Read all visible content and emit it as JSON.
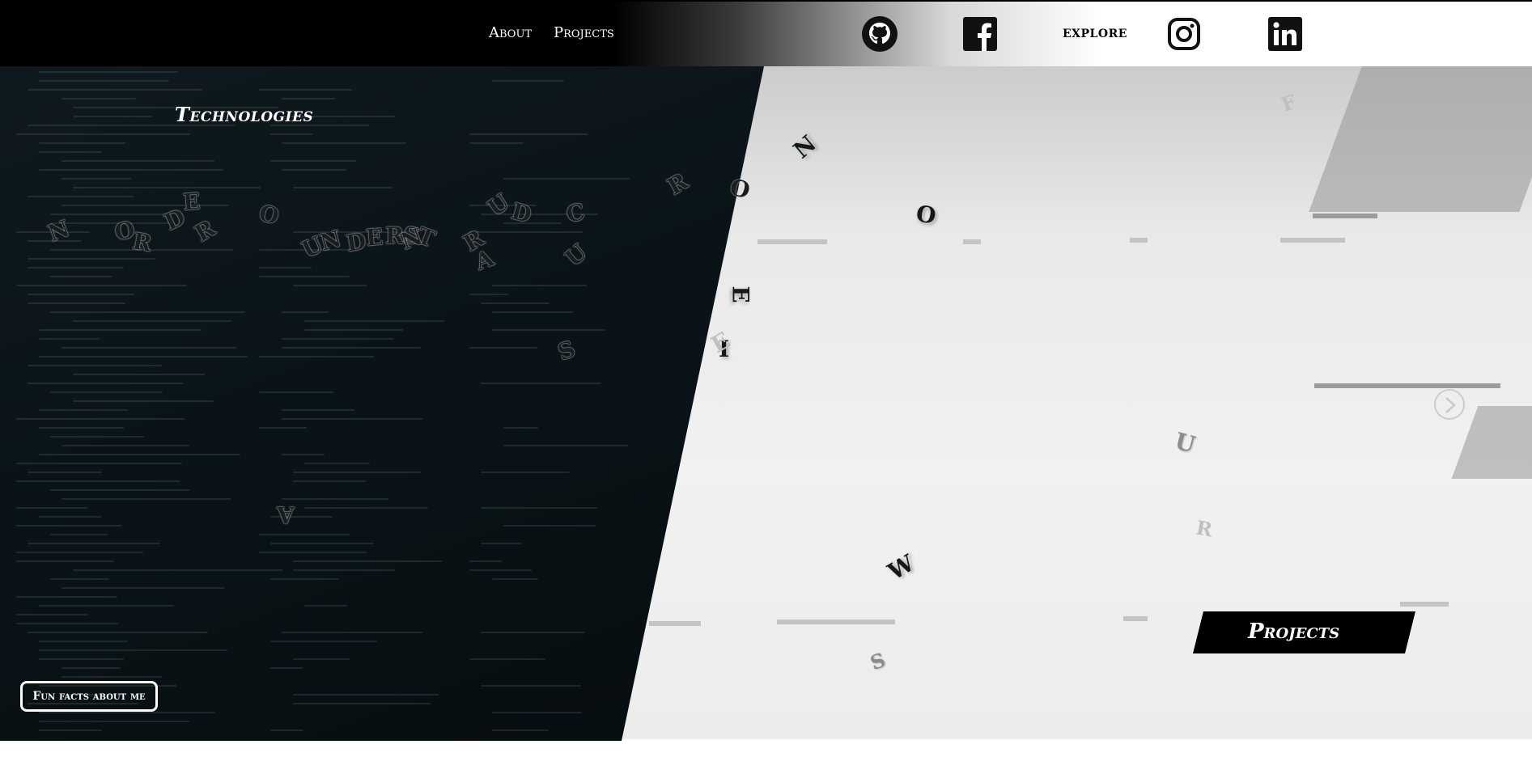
{
  "nav": {
    "about_label": "About",
    "projects_label": "Projects",
    "explore_label": "explore"
  },
  "social": {
    "github_icon": "github-icon",
    "facebook_icon": "facebook-icon",
    "instagram_icon": "instagram-icon",
    "linkedin_icon": "linkedin-icon"
  },
  "sections": {
    "technologies_title": "Technologies",
    "projects_banner": "Projects",
    "fun_facts_button": "Fun facts about me"
  },
  "icons": {
    "next_arrow": "chevron-right-circle-icon"
  },
  "letters": {
    "l01": "N",
    "l02": "O",
    "l03": "R",
    "l04": "D",
    "l05": "E",
    "l06": "R",
    "l07": "O",
    "l08": "U",
    "l09": "N",
    "l10": "D",
    "l11": "E",
    "l12": "R",
    "l13": "S",
    "l14": "T",
    "l15": "N",
    "l16": "R",
    "l17": "A",
    "l18": "U",
    "l19": "D",
    "l20": "C",
    "l21": "U",
    "l22": "S",
    "l23": "R",
    "l24": "O",
    "l25": "N",
    "l26": "O",
    "l27": "E",
    "l28": "I",
    "l29": "E",
    "l30": "F",
    "l31": "U",
    "l32": "R",
    "l33": "W",
    "l34": "S",
    "l35": "A"
  },
  "colors": {
    "dark_panel": "#0a1418",
    "topbar": "#000000",
    "accent_white": "#ffffff",
    "banner": "#000000"
  }
}
